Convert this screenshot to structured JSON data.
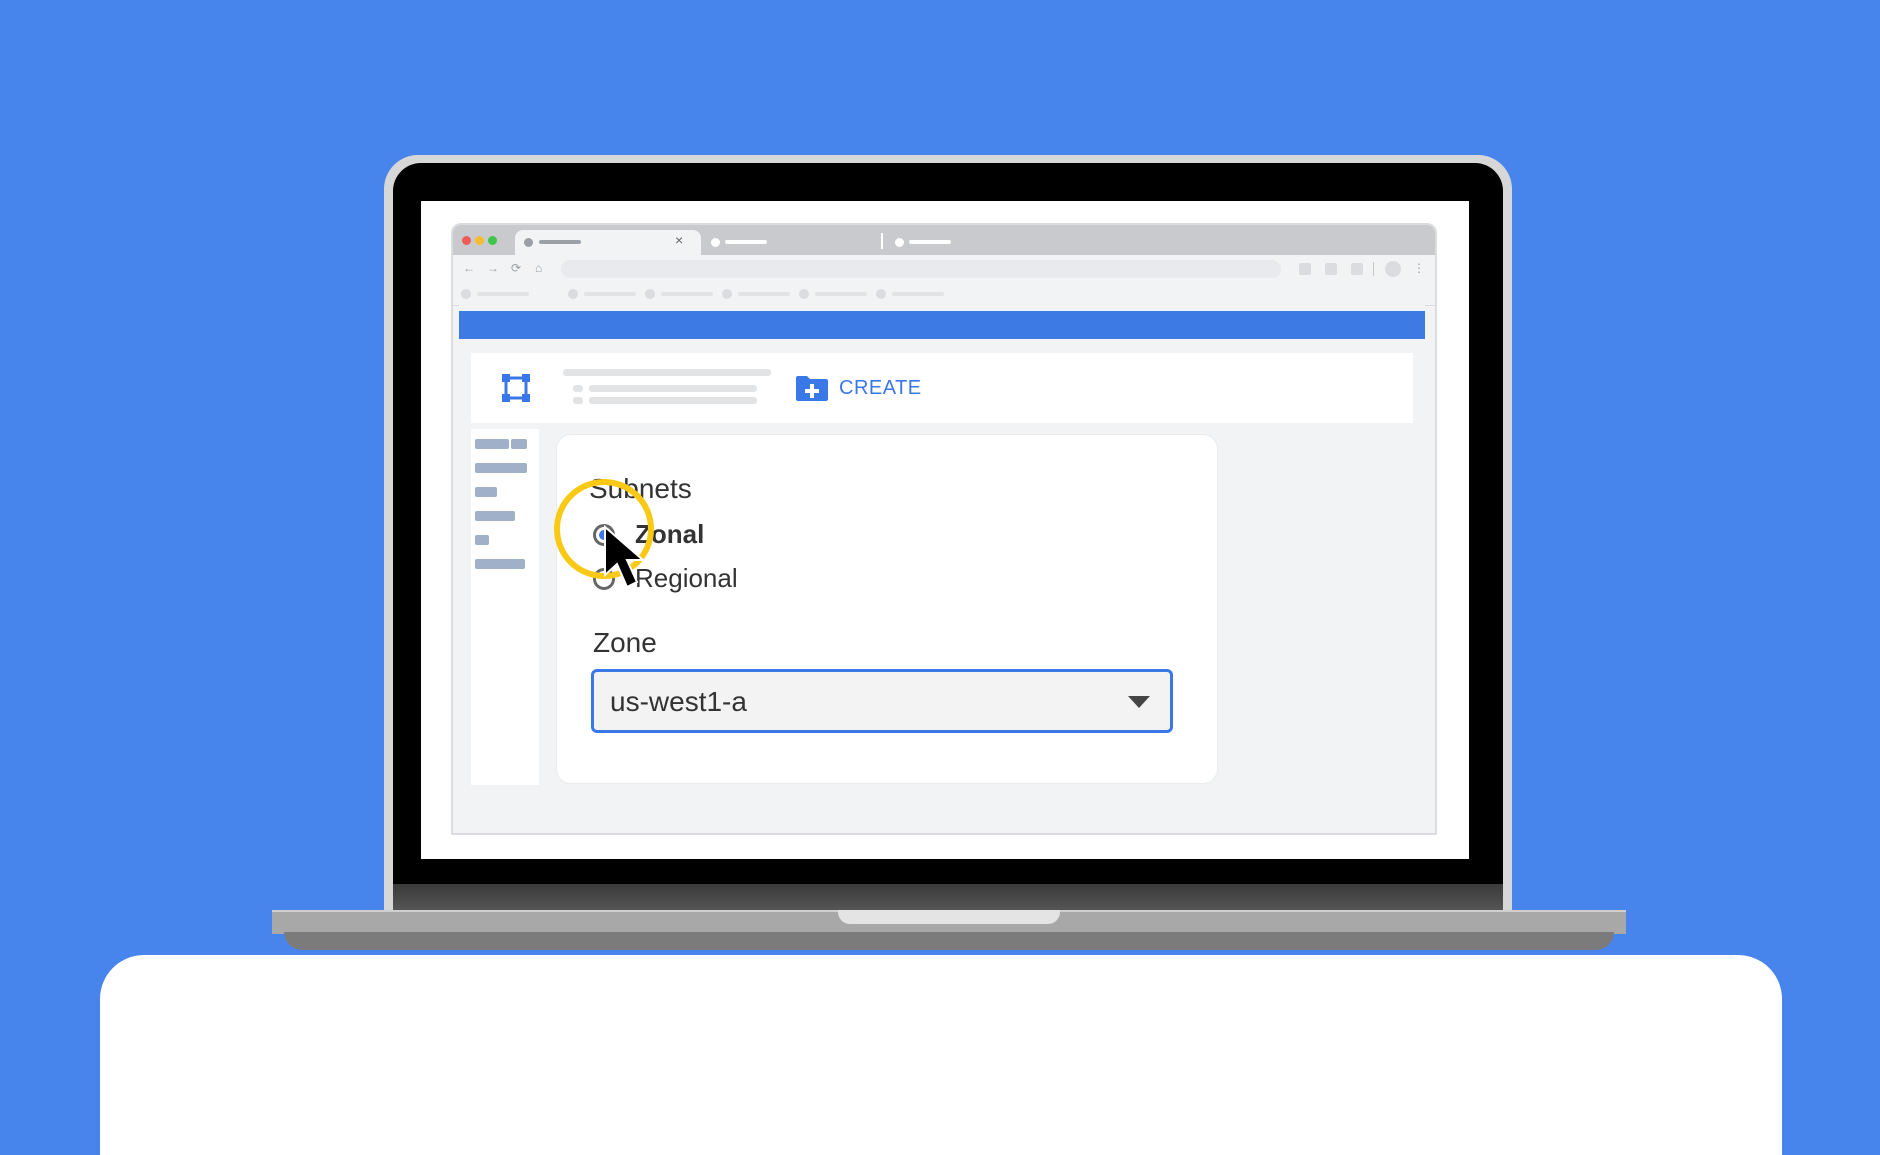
{
  "colors": {
    "background": "#4785ec",
    "accent": "#3b78e7",
    "header_bar": "#3d7ae4",
    "highlight_ring": "#f9c916",
    "traffic_red": "#ee5c57",
    "traffic_yellow": "#f6be2f",
    "traffic_green": "#3ec54a"
  },
  "toolbar": {
    "create_label": "CREATE",
    "create_icon": "folder-plus-icon",
    "logo_icon": "crop-frame-icon"
  },
  "subnets": {
    "title": "Subnets",
    "options": [
      {
        "label": "Zonal",
        "selected": true
      },
      {
        "label": "Regional",
        "selected": false
      }
    ]
  },
  "zone": {
    "label": "Zone",
    "value": "us-west1-a"
  },
  "browser": {
    "tab_close_glyph": "×",
    "nav_glyphs": [
      "←",
      "→",
      "⟳",
      "⌂"
    ],
    "menu_glyph": "⋮"
  }
}
